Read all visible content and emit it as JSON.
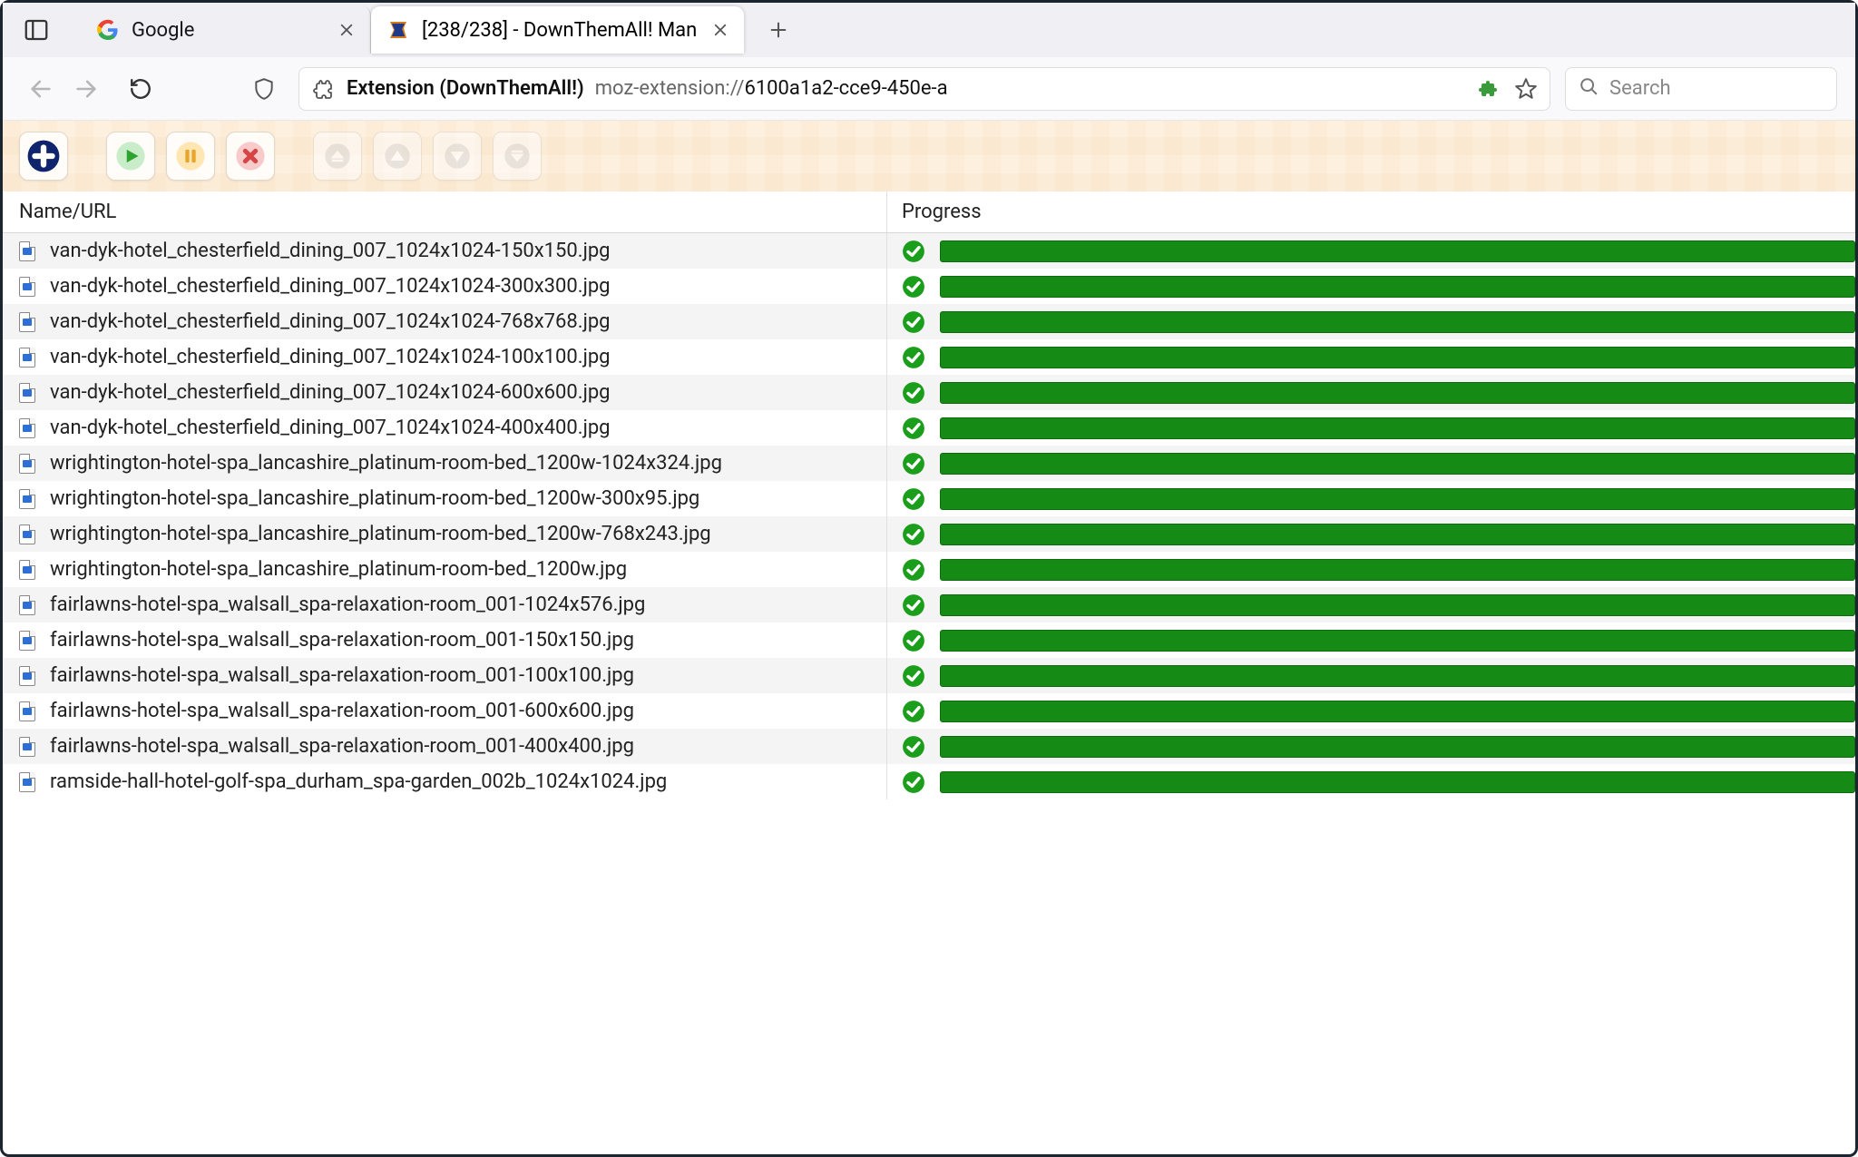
{
  "tabs": [
    {
      "title": "Google",
      "favicon": "google"
    },
    {
      "title": "[238/238] - DownThemAll! Man",
      "favicon": "dta"
    }
  ],
  "newtab_plus": "+",
  "urlbar": {
    "ext_label": "Extension (DownThemAll!)",
    "url_prefix": "moz-extension://",
    "url_rest": "6100a1a2-cce9-450e-a"
  },
  "searchbar": {
    "placeholder": "Search"
  },
  "columns": {
    "name": "Name/URL",
    "progress": "Progress"
  },
  "accent_green": "#158a15",
  "rows": [
    {
      "name": "van-dyk-hotel_chesterfield_dining_007_1024x1024-150x150.jpg",
      "complete": true
    },
    {
      "name": "van-dyk-hotel_chesterfield_dining_007_1024x1024-300x300.jpg",
      "complete": true
    },
    {
      "name": "van-dyk-hotel_chesterfield_dining_007_1024x1024-768x768.jpg",
      "complete": true
    },
    {
      "name": "van-dyk-hotel_chesterfield_dining_007_1024x1024-100x100.jpg",
      "complete": true
    },
    {
      "name": "van-dyk-hotel_chesterfield_dining_007_1024x1024-600x600.jpg",
      "complete": true
    },
    {
      "name": "van-dyk-hotel_chesterfield_dining_007_1024x1024-400x400.jpg",
      "complete": true
    },
    {
      "name": "wrightington-hotel-spa_lancashire_platinum-room-bed_1200w-1024x324.jpg",
      "complete": true
    },
    {
      "name": "wrightington-hotel-spa_lancashire_platinum-room-bed_1200w-300x95.jpg",
      "complete": true
    },
    {
      "name": "wrightington-hotel-spa_lancashire_platinum-room-bed_1200w-768x243.jpg",
      "complete": true
    },
    {
      "name": "wrightington-hotel-spa_lancashire_platinum-room-bed_1200w.jpg",
      "complete": true
    },
    {
      "name": "fairlawns-hotel-spa_walsall_spa-relaxation-room_001-1024x576.jpg",
      "complete": true
    },
    {
      "name": "fairlawns-hotel-spa_walsall_spa-relaxation-room_001-150x150.jpg",
      "complete": true
    },
    {
      "name": "fairlawns-hotel-spa_walsall_spa-relaxation-room_001-100x100.jpg",
      "complete": true
    },
    {
      "name": "fairlawns-hotel-spa_walsall_spa-relaxation-room_001-600x600.jpg",
      "complete": true
    },
    {
      "name": "fairlawns-hotel-spa_walsall_spa-relaxation-room_001-400x400.jpg",
      "complete": true
    },
    {
      "name": "ramside-hall-hotel-golf-spa_durham_spa-garden_002b_1024x1024.jpg",
      "complete": true
    }
  ]
}
